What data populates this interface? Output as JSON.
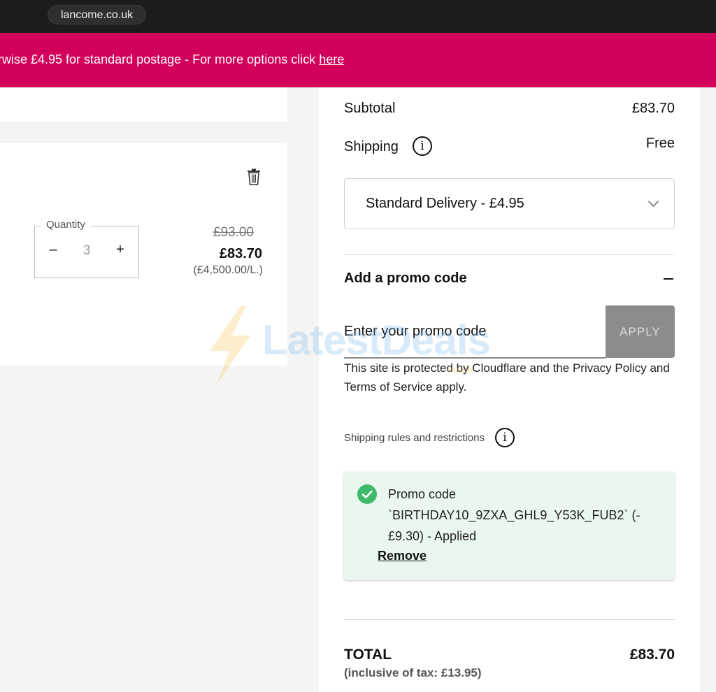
{
  "browser": {
    "url": "lancome.co.uk"
  },
  "banner": {
    "text": "rwise £4.95 for standard postage - For more options click ",
    "link": "here"
  },
  "product": {
    "quantity_label": "Quantity",
    "quantity_value": "3",
    "minus": "–",
    "plus": "+",
    "price_old": "£93.00",
    "price_new": "£83.70",
    "price_unit": "(£4,500.00/L.)"
  },
  "summary": {
    "subtotal_label": "Subtotal",
    "subtotal_value": "£83.70",
    "shipping_label": "Shipping",
    "shipping_value": "Free",
    "info_glyph": "i",
    "delivery_selected": "Standard Delivery - £4.95",
    "promo_title": "Add a promo code",
    "promo_placeholder": "Enter your promo code",
    "apply_label": "APPLY",
    "legal_text": "This site is protected by Cloudflare and the Privacy Policy and Terms of Service apply.",
    "rules_text": "Shipping rules and restrictions",
    "applied_text": "Promo code `BIRTHDAY10_9ZXA_GHL9_Y53K_FUB2` (-£9.30) - Applied",
    "remove_label": "Remove",
    "total_label": "TOTAL",
    "total_tax": "(inclusive of tax: £13.95)",
    "total_value": "£83.70"
  },
  "watermark": {
    "text": "LatestDeals",
    "sub": "co.uk"
  },
  "colors": {
    "banner": "#d3005b",
    "apply_button": "#8c8c8c",
    "success": "#3fba6b",
    "success_bg": "#eaf7ee"
  },
  "icons": [
    "trash-icon",
    "info-icon",
    "chevron-down-icon",
    "minus-icon",
    "check-circle-icon"
  ]
}
